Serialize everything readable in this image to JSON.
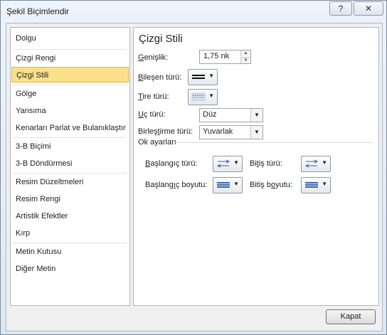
{
  "window": {
    "title": "Şekil Biçimlendir",
    "help_label": "?",
    "close_label": "✕"
  },
  "sidebar": {
    "items": [
      {
        "label": "Dolgu"
      },
      {
        "label": "Çizgi Rengi"
      },
      {
        "label": "Çizgi Stili",
        "selected": true
      },
      {
        "label": "Gölge"
      },
      {
        "label": "Yansıma"
      },
      {
        "label": "Kenarları Parlat ve Bulanıklaştır"
      },
      {
        "label": "3-B Biçimi"
      },
      {
        "label": "3-B Döndürmesi"
      },
      {
        "label": "Resim Düzeltmeleri"
      },
      {
        "label": "Resim Rengi"
      },
      {
        "label": "Artistik Efektler"
      },
      {
        "label": "Kırp"
      },
      {
        "label": "Metin Kutusu"
      },
      {
        "label": "Diğer Metin"
      }
    ]
  },
  "panel": {
    "title": "Çizgi Stili",
    "width": {
      "label_u": "G",
      "label_rest": "enişlik:",
      "value": "1,75 nk"
    },
    "compound": {
      "label_u": "B",
      "label_rest": "ileşen türü:"
    },
    "dash": {
      "label_u": "T",
      "label_rest": "ire türü:"
    },
    "cap": {
      "label_u": "U",
      "label_rest": "ç türü:",
      "value": "Düz"
    },
    "join": {
      "label_pre": "Birleş",
      "label_u": "t",
      "label_rest": "irme türü:",
      "value": "Yuvarlak"
    },
    "arrows": {
      "heading": "Ok ayarları",
      "begin_type": {
        "label_u": "B",
        "label_rest": "aşlangıç türü:"
      },
      "end_type": {
        "label_pre": "Bi",
        "label_u": "t",
        "label_rest": "iş türü:"
      },
      "begin_size": {
        "label_pre": "Başlang",
        "label_u": "ı",
        "label_rest": "ç boyutu:"
      },
      "end_size": {
        "label_pre": "Bitiş b",
        "label_u": "o",
        "label_rest": "yutu:"
      }
    }
  },
  "footer": {
    "close_button": "Kapat"
  },
  "colors": {
    "selection_fill": "#fbe08a",
    "selection_border": "#e0b54a",
    "icon_blue": "#3a64a8"
  }
}
